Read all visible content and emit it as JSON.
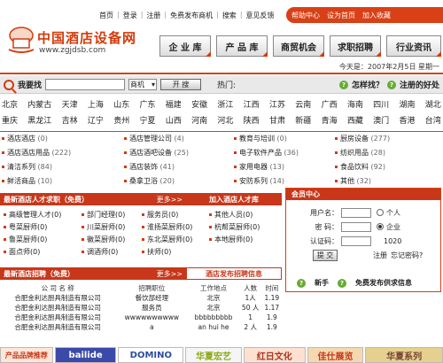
{
  "logo": {
    "cn": "中国酒店设备网",
    "url": "www.zgjdsb.com"
  },
  "topnav": [
    "首页",
    "登录",
    "注册",
    "免费发布商机",
    "搜索",
    "意见反馈"
  ],
  "redbar": [
    "帮助中心",
    "设为首页",
    "加入收藏"
  ],
  "mainnav": [
    "企 业 库",
    "产 品 库",
    "商贸机会",
    "求职招聘",
    "行业资讯"
  ],
  "date": "今天是：2007年2月5日 星期一",
  "search": {
    "title": "我要找",
    "input_value": "",
    "select_value": "商机",
    "button": "开 搜",
    "hot_label": "热门:",
    "how": "怎样找？",
    "register": "注册的好处"
  },
  "regions": [
    [
      "北京",
      "内蒙古",
      "天津",
      "上海",
      "山东",
      "广东",
      "福建",
      "安徽",
      "浙江",
      "江西",
      "江苏",
      "云南",
      "广西",
      "海南",
      "四川",
      "湖南",
      "湖北"
    ],
    [
      "重庆",
      "黑龙江",
      "吉林",
      "辽宁",
      "贵州",
      "宁夏",
      "山西",
      "河南",
      "河北",
      "陕西",
      "甘肃",
      "新疆",
      "青海",
      "西藏",
      "澳门",
      "香港",
      "台湾"
    ]
  ],
  "categories": [
    {
      "name": "酒店酒店",
      "count": "(0)"
    },
    {
      "name": "酒店管理公司",
      "count": "(4)"
    },
    {
      "name": "教育与培训",
      "count": "(0)"
    },
    {
      "name": "厨房设备",
      "count": "(277)"
    },
    {
      "name": "酒店酒店用品",
      "count": "(222)"
    },
    {
      "name": "酒店酒吧设备",
      "count": "(25)"
    },
    {
      "name": "电子软件产品",
      "count": "(36)"
    },
    {
      "name": "纺织用品",
      "count": "(28)"
    },
    {
      "name": "清洁系列",
      "count": "(84)"
    },
    {
      "name": "酒店装饰",
      "count": "(41)"
    },
    {
      "name": "家用电器",
      "count": "(13)"
    },
    {
      "name": "食品饮料",
      "count": "(92)"
    },
    {
      "name": "鲜活商品",
      "count": "(10)"
    },
    {
      "name": "桑拿卫浴",
      "count": "(20)"
    },
    {
      "name": "安防系列",
      "count": "(14)"
    },
    {
      "name": "其他",
      "count": "(32)"
    }
  ],
  "section1": {
    "title": "最新酒店人才求职（免费）",
    "more": "更多>>",
    "right": "加入酒店人才库"
  },
  "jobs": [
    "高级管理人才",
    "部门经理",
    "服务员",
    "其他人员",
    "粤菜厨师",
    "川菜厨师",
    "淮扬菜厨师",
    "杭帮菜厨师",
    "鲁菜厨师",
    "徽菜厨师",
    "东北菜厨师",
    "本地厨师",
    "面点师",
    "调酒师",
    "扶师"
  ],
  "job_counts": [
    "(0)",
    "(0)",
    "(0)",
    "(0)",
    "(0)",
    "(0)",
    "(0)",
    "(0)",
    "(0)",
    "(0)",
    "(0)",
    "(0)",
    "(0)",
    "(0)",
    "(0)"
  ],
  "section2": {
    "title": "最新酒店招聘（免费）",
    "more": "更多>>",
    "right": "酒店发布招聘信息"
  },
  "table": {
    "headers": [
      "公 司 名 称",
      "招聘职位",
      "工作地点",
      "人数",
      "时间"
    ],
    "rows": [
      [
        "合肥金利达厨具制造有限公司",
        "餐饮部经理",
        "北京",
        "1人",
        "1.19"
      ],
      [
        "合肥金利达厨具制造有限公司",
        "服务员",
        "北京",
        "50 人",
        "1.17"
      ],
      [
        "合肥金利达厨具制造有限公司",
        "wwwwwwwwww",
        "bbbbbbbbb",
        "1",
        "1.9"
      ],
      [
        "合肥金利达厨具制造有限公司",
        "a",
        "an hui he",
        "2 人",
        "1.9"
      ]
    ]
  },
  "member": {
    "title": "会员中心",
    "username_label": "用户名：",
    "password_label": "密  码：",
    "captcha_label": "认证码：",
    "captcha_value": "1020",
    "radio1": "个人",
    "radio2": "企业",
    "submit": "提 交",
    "register": "注册",
    "forgot": "忘记密码?",
    "newbie": "新手",
    "free_post": "免费发布供求信息"
  },
  "ads": [
    "产品品牌推荐",
    "bailide",
    "DOMINO",
    "华夏宏艺",
    "红日文化",
    "佳仕展览",
    "华夏系列"
  ]
}
